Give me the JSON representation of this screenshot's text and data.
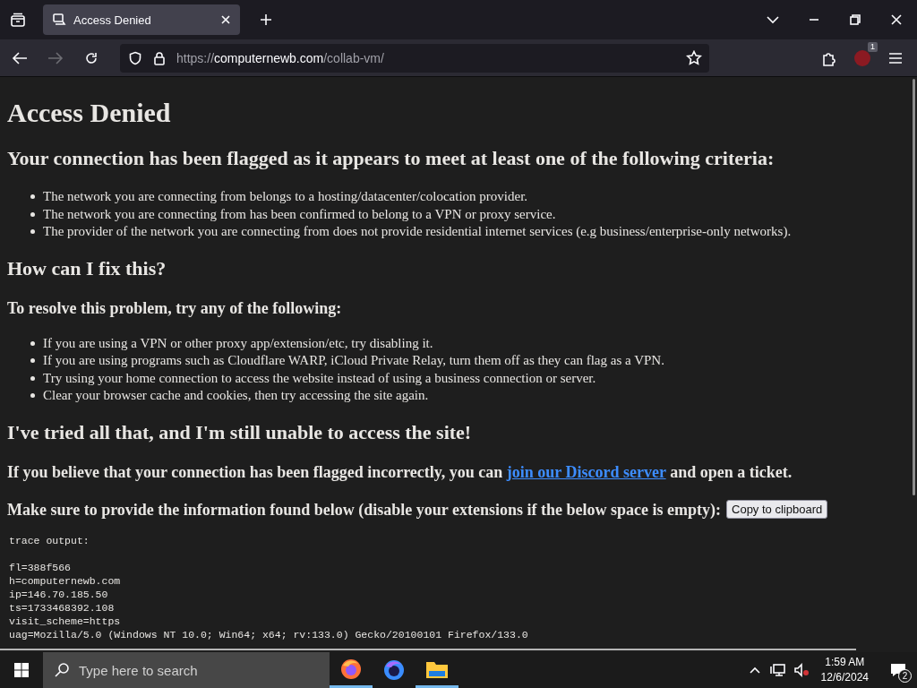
{
  "browser": {
    "tabs": [
      {
        "title": "Access Denied",
        "selected": true
      }
    ],
    "address": {
      "scheme": "https://",
      "host": "computernewb.com",
      "path": "/collab-vm/"
    },
    "extension_badge": "1"
  },
  "page": [
    {
      "kind": "h1",
      "text": "Access Denied"
    },
    {
      "kind": "h2",
      "text": "Your connection has been flagged as it appears to meet at least one of the following criteria:"
    },
    {
      "kind": "list",
      "items": [
        "The network you are connecting from belongs to a hosting/datacenter/colocation provider.",
        "The network you are connecting from has been confirmed to belong to a VPN or proxy service.",
        "The provider of the network you are connecting from does not provide residential internet services (e.g business/enterprise-only networks)."
      ]
    },
    {
      "kind": "h2",
      "text": "How can I fix this?"
    },
    {
      "kind": "h3",
      "text": "To resolve this problem, try any of the following:"
    },
    {
      "kind": "list",
      "items": [
        "If you are using a VPN or other proxy app/extension/etc, try disabling it.",
        "If you are using programs such as Cloudflare WARP, iCloud Private Relay, turn them off as they can flag as a VPN.",
        "Try using your home connection to access the website instead of using a business connection or server.",
        "Clear your browser cache and cookies, then try accessing the site again."
      ]
    },
    {
      "kind": "h2",
      "text": "I've tried all that, and I'm still unable to access the site!"
    },
    {
      "kind": "link_para",
      "before": "If you believe that your connection has been flagged incorrectly, you can ",
      "link": "join our Discord server",
      "after": " and open a ticket."
    },
    {
      "kind": "button_para",
      "text": "Make sure to provide the information found below (disable your extensions if the below space is empty):",
      "button": "Copy to clipboard"
    },
    {
      "kind": "pre",
      "title": "trace output:",
      "lines": [
        "fl=388f566",
        "h=computernewb.com",
        "ip=146.70.185.50",
        "ts=1733468392.108",
        "visit_scheme=https",
        "uag=Mozilla/5.0 (Windows NT 10.0; Win64; x64; rv:133.0) Gecko/20100101 Firefox/133.0"
      ]
    }
  ],
  "taskbar": {
    "search_placeholder": "Type here to search",
    "time": "1:59 AM",
    "date": "12/6/2024",
    "notifications": "2"
  }
}
